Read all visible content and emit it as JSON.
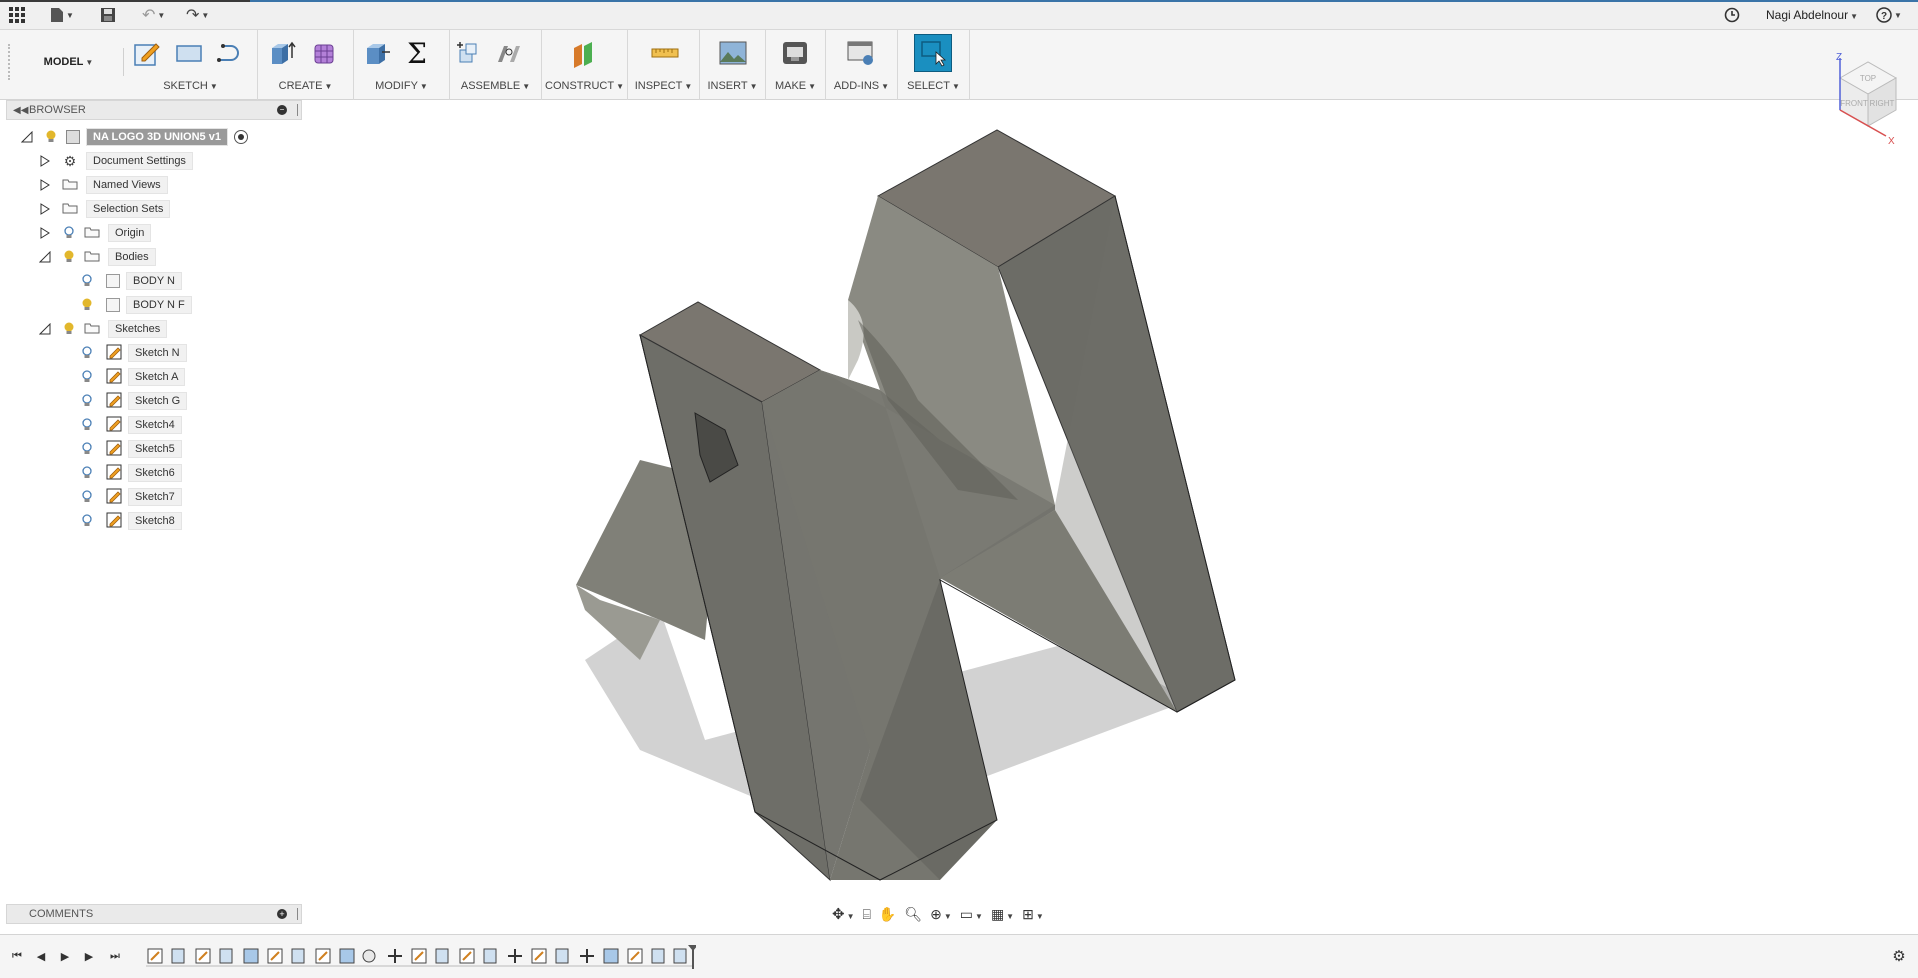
{
  "topbar": {
    "user_name": "Nagi Abdelnour",
    "icons": [
      "app-grid-icon",
      "file-icon",
      "save-icon",
      "undo-icon",
      "redo-icon",
      "job-status-icon",
      "help-icon"
    ]
  },
  "ribbon": {
    "workspace": "MODEL",
    "groups": {
      "sketch": "SKETCH",
      "create": "CREATE",
      "modify": "MODIFY",
      "assemble": "ASSEMBLE",
      "construct": "CONSTRUCT",
      "inspect": "INSPECT",
      "insert": "INSERT",
      "make": "MAKE",
      "addins": "ADD-INS",
      "select": "SELECT"
    }
  },
  "browser": {
    "title": "BROWSER",
    "root": "NA LOGO 3D UNION5 v1",
    "folders": {
      "document_settings": "Document Settings",
      "named_views": "Named Views",
      "selection_sets": "Selection Sets",
      "origin": "Origin",
      "bodies": "Bodies",
      "sketches": "Sketches"
    },
    "bodies": [
      "BODY N",
      "BODY N F"
    ],
    "sketches": [
      "Sketch N",
      "Sketch A",
      "Sketch G",
      "Sketch4",
      "Sketch5",
      "Sketch6",
      "Sketch7",
      "Sketch8"
    ]
  },
  "comments": {
    "title": "COMMENTS"
  },
  "viewcube": {
    "top": "TOP",
    "front": "FRONT",
    "right": "RIGHT",
    "axis_z": "Z",
    "axis_x": "X"
  },
  "colors": {
    "accent_blue": "#3a74a8",
    "select_tool": "#1a8fc0",
    "model_face": "#6b6b66",
    "model_top": "#7a7770",
    "bulb": "#e2b72c"
  }
}
